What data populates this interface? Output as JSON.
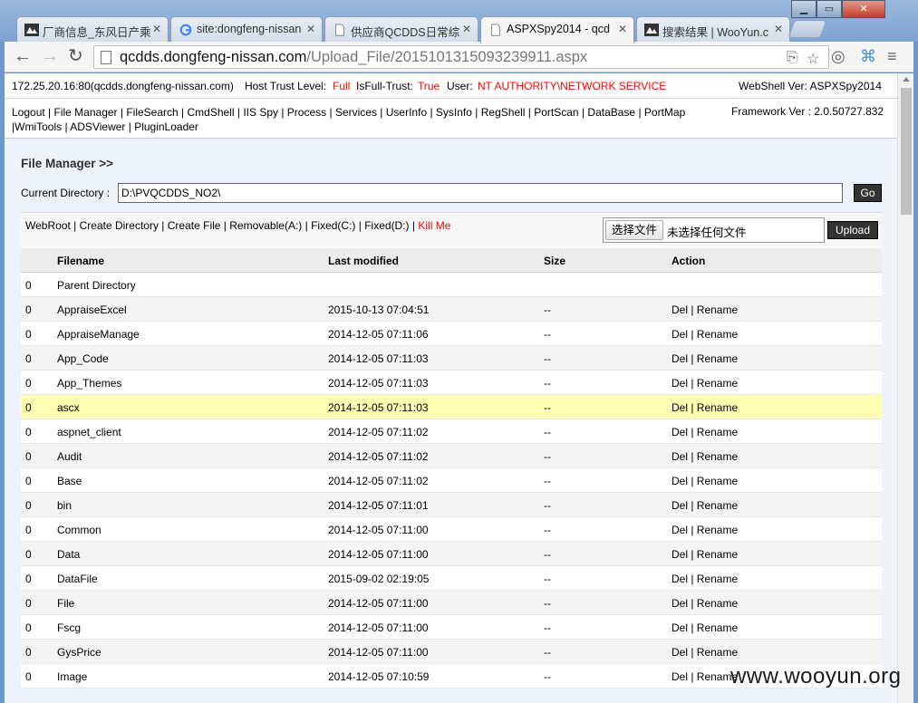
{
  "browser": {
    "tabs": [
      {
        "label": "厂商信息_东风日产乘"
      },
      {
        "label": "site:dongfeng-nissan"
      },
      {
        "label": "供应商QCDDS日常综"
      },
      {
        "label": "ASPXSpy2014 - qcd"
      },
      {
        "label": "搜索结果 | WooYun.c"
      }
    ],
    "url_host": "qcdds.dongfeng-nissan.com",
    "url_path": "/Upload_File/20151013150932399­11.aspx"
  },
  "info": {
    "host": "172.25.20.16:80(qcdds.dongfeng-nissan.com)",
    "trust_label": "Host Trust Level:",
    "trust_value": "Full",
    "fulltrust_label": "IsFull-Trust:",
    "fulltrust_value": "True",
    "user_label": "User:",
    "user_value": "NT AUTHORITY\\NETWORK SERVICE",
    "webshell_ver": "WebShell Ver: ASPXSpy2014",
    "framework_ver": "Framework Ver : 2.0.50727.832"
  },
  "menu": {
    "items": [
      "Logout",
      "File Manager",
      "FileSearch",
      "CmdShell",
      "IIS Spy",
      "Process",
      "Services",
      "UserInfo",
      "SysInfo",
      "RegShell",
      "PortScan",
      "DataBase",
      "PortMap",
      "WmiTools",
      "ADSViewer",
      "PluginLoader"
    ]
  },
  "file_manager": {
    "title": "File Manager >>",
    "current_dir_label": "Current Directory :",
    "current_dir_value": "D:\\PVQCDDS_NO2\\",
    "go_label": "Go",
    "links": [
      "WebRoot",
      "Create Directory",
      "Create File",
      "Removable(A:)",
      "Fixed(C:)",
      "Fixed(D:)"
    ],
    "kill_label": "Kill Me",
    "choose_file_label": "选择文件",
    "no_file_label": "未选择任何文件",
    "upload_label": "Upload",
    "columns": [
      "Filename",
      "Last modified",
      "Size",
      "Action"
    ],
    "rows": [
      {
        "n": "0",
        "name": "Parent Directory",
        "date": "",
        "size": "",
        "action": ""
      },
      {
        "n": "0",
        "name": "AppraiseExcel",
        "date": "2015-10-13 07:04:51",
        "size": "--",
        "action": "Del | Rename"
      },
      {
        "n": "0",
        "name": "AppraiseManage",
        "date": "2014-12-05 07:11:06",
        "size": "--",
        "action": "Del | Rename"
      },
      {
        "n": "0",
        "name": "App_Code",
        "date": "2014-12-05 07:11:03",
        "size": "--",
        "action": "Del | Rename"
      },
      {
        "n": "0",
        "name": "App_Themes",
        "date": "2014-12-05 07:11:03",
        "size": "--",
        "action": "Del | Rename"
      },
      {
        "n": "0",
        "name": "ascx",
        "date": "2014-12-05 07:11:03",
        "size": "--",
        "action": "Del | Rename"
      },
      {
        "n": "0",
        "name": "aspnet_client",
        "date": "2014-12-05 07:11:02",
        "size": "--",
        "action": "Del | Rename"
      },
      {
        "n": "0",
        "name": "Audit",
        "date": "2014-12-05 07:11:02",
        "size": "--",
        "action": "Del | Rename"
      },
      {
        "n": "0",
        "name": "Base",
        "date": "2014-12-05 07:11:02",
        "size": "--",
        "action": "Del | Rename"
      },
      {
        "n": "0",
        "name": "bin",
        "date": "2014-12-05 07:11:01",
        "size": "--",
        "action": "Del | Rename"
      },
      {
        "n": "0",
        "name": "Common",
        "date": "2014-12-05 07:11:00",
        "size": "--",
        "action": "Del | Rename"
      },
      {
        "n": "0",
        "name": "Data",
        "date": "2014-12-05 07:11:00",
        "size": "--",
        "action": "Del | Rename"
      },
      {
        "n": "0",
        "name": "DataFile",
        "date": "2015-09-02 02:19:05",
        "size": "--",
        "action": "Del | Rename"
      },
      {
        "n": "0",
        "name": "File",
        "date": "2014-12-05 07:11:00",
        "size": "--",
        "action": "Del | Rename"
      },
      {
        "n": "0",
        "name": "Fscg",
        "date": "2014-12-05 07:11:00",
        "size": "--",
        "action": "Del | Rename"
      },
      {
        "n": "0",
        "name": "GysPrice",
        "date": "2014-12-05 07:11:00",
        "size": "--",
        "action": "Del | Rename"
      },
      {
        "n": "0",
        "name": "Image",
        "date": "2014-12-05 07:10:59",
        "size": "--",
        "action": "Del | Rename"
      }
    ]
  },
  "watermark": "www.wooyun.org"
}
